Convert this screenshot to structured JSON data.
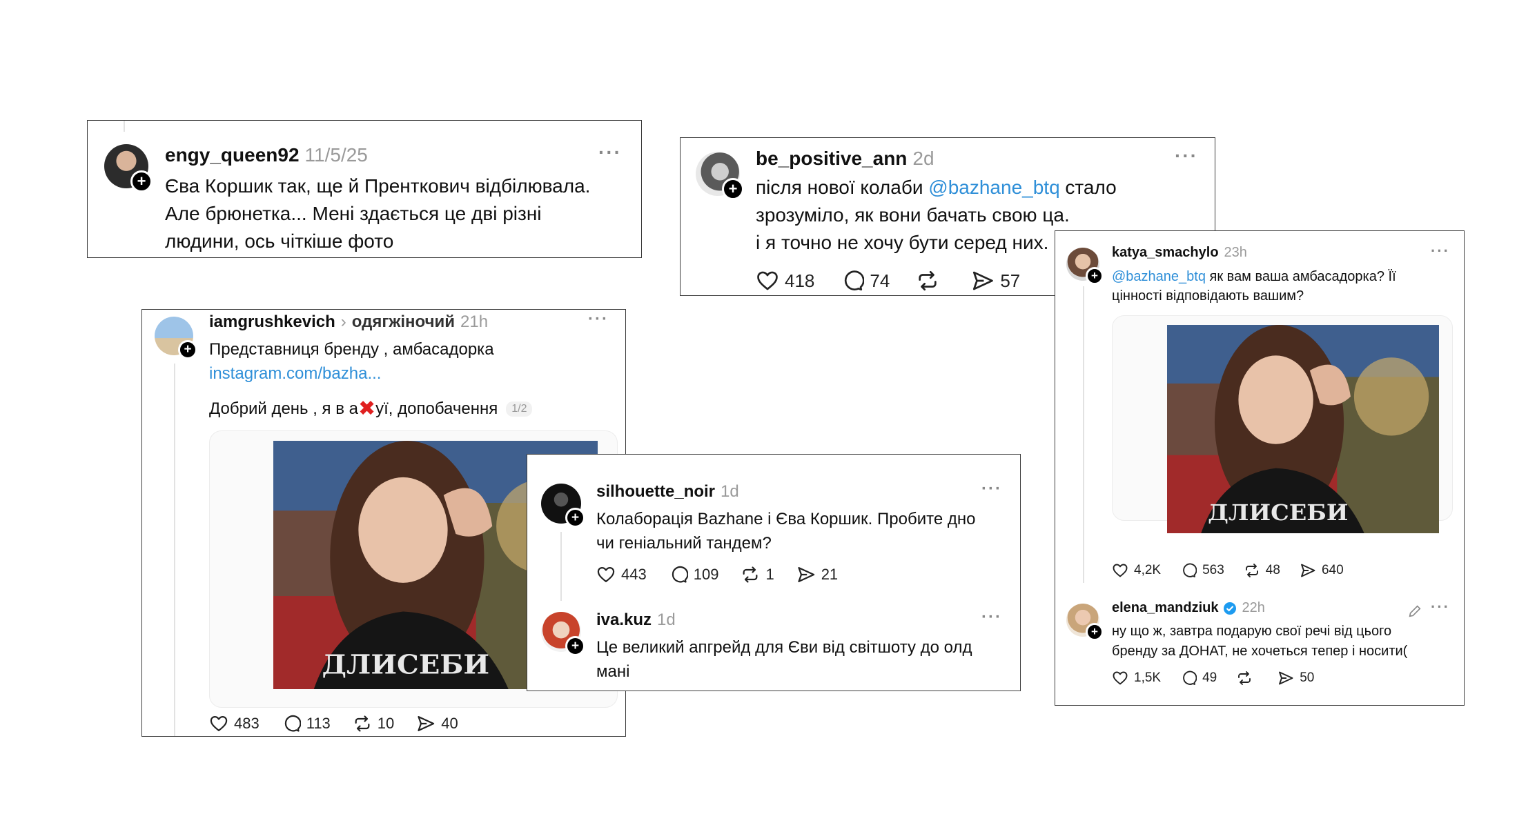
{
  "colors": {
    "link": "#2f8fd8",
    "verified": "#1d9bf0",
    "border": "#3a3a3a",
    "timestamp": "#9a9a9a"
  },
  "card1": {
    "username": "engy_queen92",
    "time": "11/5/25",
    "lines": [
      "Єва Коршик так, ще й Пренткович відбілювала.",
      "Але брюнетка... Мені здається це дві різні",
      "людини, ось чіткіше фото"
    ]
  },
  "card2": {
    "username": "be_positive_ann",
    "time": "2d",
    "line1_pre": "після нової колаби ",
    "line1_mention": "@bazhane_btq",
    "line1_post": " стало",
    "line2": "зрозуміло, як вони бачать свою ца.",
    "line3": "і я точно не хочу бути серед них.",
    "likes": "418",
    "replies": "74",
    "shares": "57"
  },
  "card3": {
    "username": "iamgrushkevich",
    "topic": "одягжіночий",
    "time": "21h",
    "line1": "Представниця бренду , амбасадорка",
    "link": "instagram.com/bazha...",
    "line2_pre": "Добрий день , я в а",
    "line2_post": "уї, допобачення",
    "page": "1/2",
    "likes": "483",
    "replies": "113",
    "reposts": "10",
    "shares": "40"
  },
  "card4": {
    "username": "silhouette_noir",
    "time": "1d",
    "lines": [
      "Колаборація Bazhane і Єва Коршик. Пробите дно",
      "чи геніальний тандем?"
    ],
    "likes": "443",
    "replies": "109",
    "reposts": "1",
    "shares": "21",
    "reply": {
      "username": "iva.kuz",
      "time": "1d",
      "lines": [
        "Це великий апгрейд для Єви від світшоту до олд",
        "мані"
      ]
    }
  },
  "card5": {
    "username": "katya_smachylo",
    "time": "23h",
    "mention": "@bazhane_btq",
    "line1_post": " як вам ваша амбасадорка? Її",
    "line2": "цінності відповідають вашим?",
    "likes": "4,2K",
    "replies": "563",
    "reposts": "48",
    "shares": "640",
    "reply": {
      "username": "elena_mandziuk",
      "time": "22h",
      "lines": [
        "ну що ж, завтра подарую свої речі від цього",
        "бренду за ДОНАТ, не хочеться тепер і носити("
      ],
      "likes": "1,5K",
      "replies": "49",
      "shares": "50"
    }
  },
  "icons": [
    "plus-icon",
    "more-dots-icon",
    "heart-icon",
    "comment-icon",
    "repost-icon",
    "share-icon",
    "chevron-right-icon",
    "red-x-emoji-icon",
    "verified-icon",
    "edit-icon"
  ]
}
